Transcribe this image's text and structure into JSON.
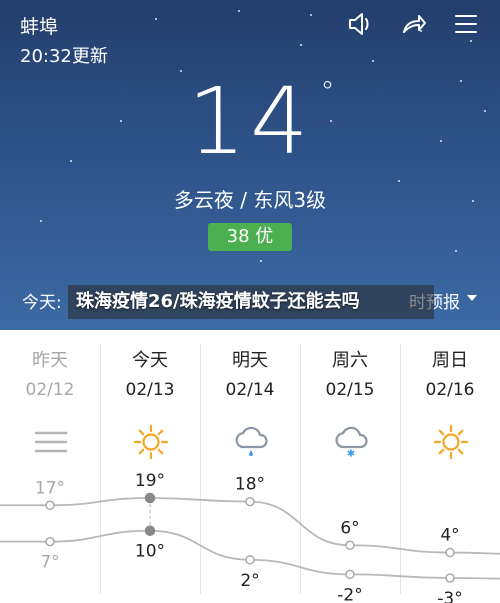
{
  "header": {
    "city": "蚌埠",
    "update_time": "20:32更新"
  },
  "current": {
    "temperature": "14",
    "degree_symbol": "°",
    "condition": "多云夜  /  东风3级",
    "aqi": "38  优",
    "aqi_color": "#4cb050",
    "today_label": "今天:",
    "forecast_toggle": "时预报"
  },
  "banner": {
    "text": "珠海疫情26/珠海疫情蚊子还能去吗"
  },
  "toolbar": {
    "icons": [
      "speaker-icon",
      "share-icon",
      "menu-icon"
    ]
  },
  "forecast": {
    "days": [
      {
        "name": "昨天",
        "date": "02/12",
        "icon": "haze-icon",
        "high": "17°",
        "low": "7°",
        "past": true
      },
      {
        "name": "今天",
        "date": "02/13",
        "icon": "sun-icon",
        "high": "19°",
        "low": "10°",
        "past": false
      },
      {
        "name": "明天",
        "date": "02/14",
        "icon": "rain-cloud-icon",
        "high": "18°",
        "low": "2°",
        "past": false
      },
      {
        "name": "周六",
        "date": "02/15",
        "icon": "snow-cloud-icon",
        "high": "6°",
        "low": "-2°",
        "past": false
      },
      {
        "name": "周日",
        "date": "02/16",
        "icon": "sun-icon",
        "high": "4°",
        "low": "-3°",
        "past": false
      }
    ]
  },
  "chart_data": {
    "type": "line",
    "categories": [
      "02/12",
      "02/13",
      "02/14",
      "02/15",
      "02/16"
    ],
    "series": [
      {
        "values": [
          17,
          19,
          18,
          6,
          4
        ]
      },
      {
        "values": [
          7,
          10,
          2,
          -2,
          -3
        ]
      }
    ]
  },
  "colors": {
    "sky_top": "#233e6c",
    "sky_bottom": "#3c6aa4",
    "sun": "#f5a623",
    "cloud": "#8c97a5",
    "rain": "#3d9be9",
    "line": "#b8b8b8"
  }
}
